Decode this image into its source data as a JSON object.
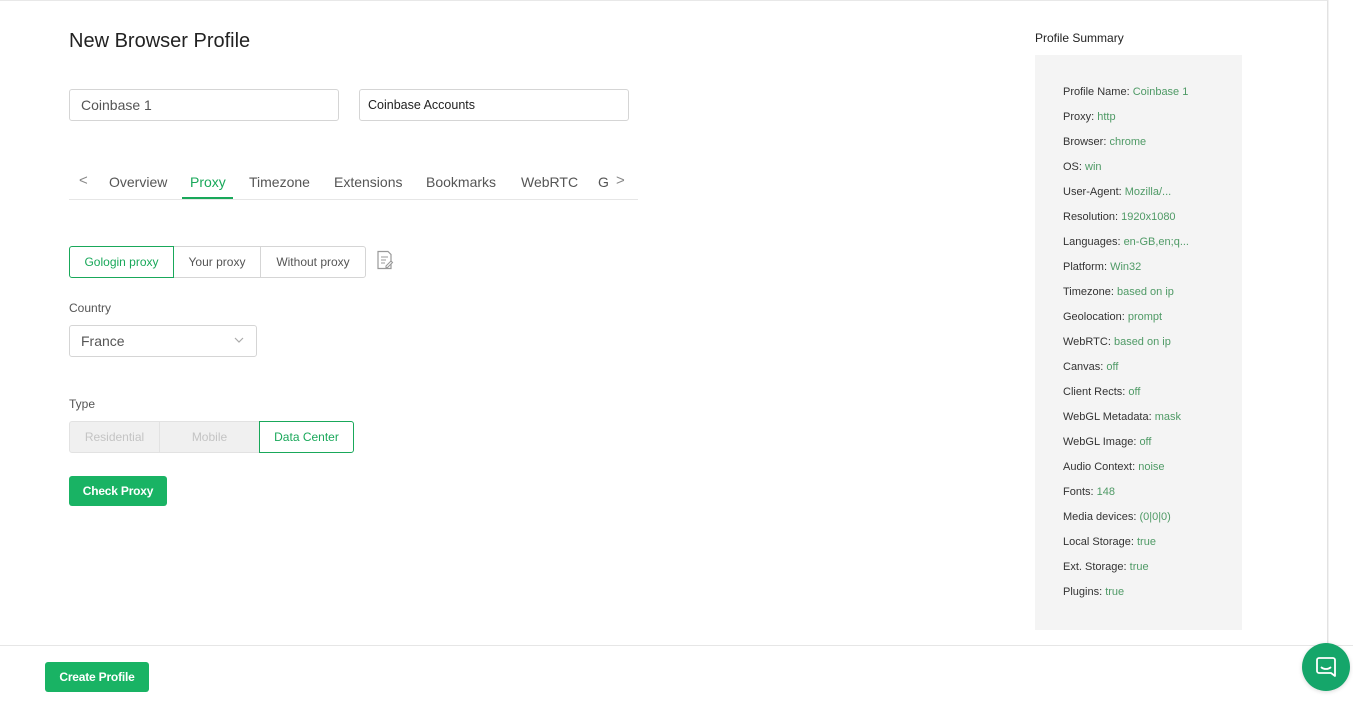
{
  "page": {
    "title": "New Browser Profile"
  },
  "form": {
    "profile_name": "Coinbase 1",
    "folder": "Coinbase Accounts"
  },
  "tabs": {
    "left_arrow": "<",
    "right_arrow": ">",
    "items": [
      {
        "label": "Overview"
      },
      {
        "label": "Proxy",
        "active": true
      },
      {
        "label": "Timezone"
      },
      {
        "label": "Extensions"
      },
      {
        "label": "Bookmarks"
      },
      {
        "label": "WebRTC"
      },
      {
        "label": "G"
      }
    ]
  },
  "proxy": {
    "modes": [
      "Gologin proxy",
      "Your proxy",
      "Without proxy"
    ],
    "selected_mode": "Gologin proxy",
    "country_label": "Country",
    "country_value": "France",
    "type_label": "Type",
    "types": [
      "Residential",
      "Mobile",
      "Data Center"
    ],
    "selected_type": "Data Center",
    "check_button": "Check Proxy"
  },
  "summary": {
    "title": "Profile Summary",
    "rows": [
      {
        "key": "Profile Name:",
        "value": "Coinbase 1"
      },
      {
        "key": "Proxy:",
        "value": "http"
      },
      {
        "key": "Browser:",
        "value": "chrome"
      },
      {
        "key": "OS:",
        "value": "win"
      },
      {
        "key": "User-Agent:",
        "value": "Mozilla/..."
      },
      {
        "key": "Resolution:",
        "value": "1920x1080"
      },
      {
        "key": "Languages:",
        "value": "en-GB,en;q..."
      },
      {
        "key": "Platform:",
        "value": "Win32"
      },
      {
        "key": "Timezone:",
        "value": "based on ip"
      },
      {
        "key": "Geolocation:",
        "value": "prompt"
      },
      {
        "key": "WebRTC:",
        "value": "based on ip"
      },
      {
        "key": "Canvas:",
        "value": "off"
      },
      {
        "key": "Client Rects:",
        "value": "off"
      },
      {
        "key": "WebGL Metadata:",
        "value": "mask"
      },
      {
        "key": "WebGL Image:",
        "value": "off"
      },
      {
        "key": "Audio Context:",
        "value": "noise"
      },
      {
        "key": "Fonts:",
        "value": "148"
      },
      {
        "key": "Media devices:",
        "value": "(0|0|0)"
      },
      {
        "key": "Local Storage:",
        "value": "true"
      },
      {
        "key": "Ext. Storage:",
        "value": "true"
      },
      {
        "key": "Plugins:",
        "value": "true"
      }
    ]
  },
  "footer": {
    "create_button": "Create Profile"
  },
  "colors": {
    "accent": "#19b364",
    "accent_text": "#19a85a",
    "summary_value": "#4f9a66"
  },
  "icons": [
    "edit-note-icon",
    "chevron-down-icon",
    "chat-icon"
  ]
}
